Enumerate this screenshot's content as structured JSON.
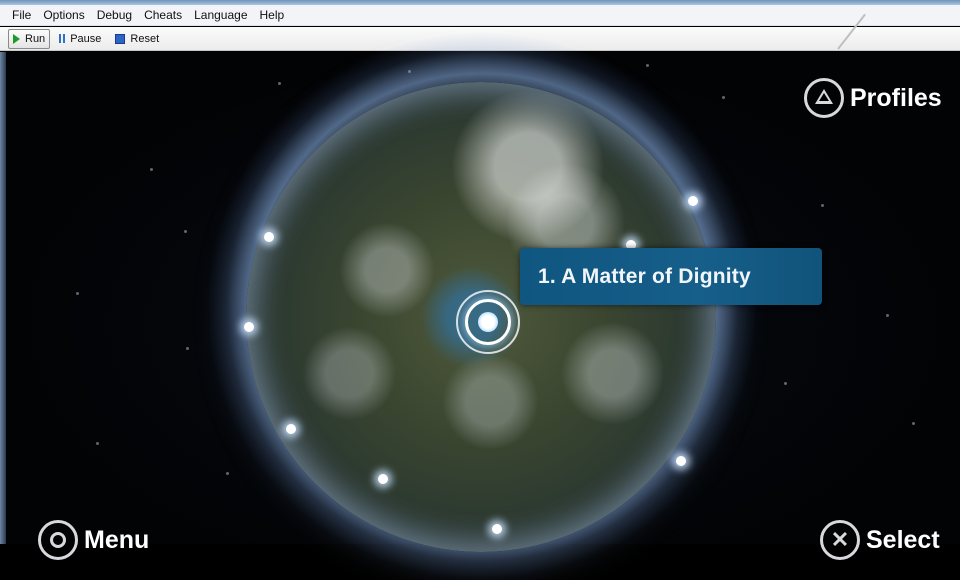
{
  "menubar": {
    "items": [
      "File",
      "Options",
      "Debug",
      "Cheats",
      "Language",
      "Help"
    ]
  },
  "toolbar": {
    "run_label": "Run",
    "pause_label": "Pause",
    "reset_label": "Reset"
  },
  "game": {
    "mission_label": "1. A Matter of Dignity",
    "profiles_label": "Profiles",
    "menu_label": "Menu",
    "select_label": "Select"
  },
  "icons": {
    "run": "play-icon",
    "pause": "pause-icon",
    "reset": "stop-icon",
    "profiles": "triangle-button-icon",
    "menu": "circle-button-icon",
    "select": "cross-button-icon"
  },
  "colors": {
    "mission_box": "#165f8a",
    "run_icon": "#1f9a2a",
    "pause_icon": "#2f6fc9",
    "reset_icon": "#2d64c7",
    "menubar_bg": "#f2f4f7"
  }
}
